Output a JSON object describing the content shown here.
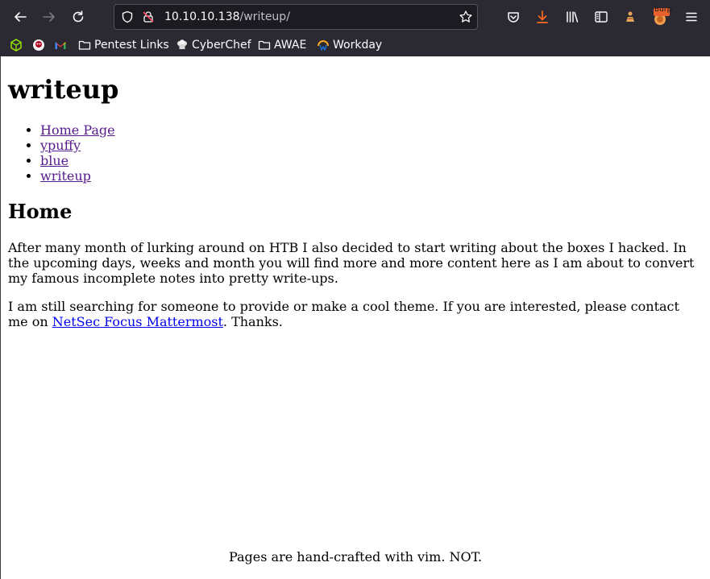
{
  "browser": {
    "url_host": "10.10.10.138",
    "url_path": "/writeup/",
    "bookmarks": [
      "Pentest Links",
      "CyberChef",
      "AWAE",
      "Workday"
    ],
    "burp_badge": "Burp"
  },
  "page": {
    "title": "writeup",
    "nav": [
      "Home Page",
      "ypuffy",
      "blue",
      "writeup"
    ],
    "heading": "Home",
    "paragraph1": "After many month of lurking around on HTB I also decided to start writing about the boxes I hacked. In the upcoming days, weeks and month you will find more and more content here as I am about to convert my famous incomplete notes into pretty write-ups.",
    "paragraph2_before": "I am still searching for someone to provide or make a cool theme. If you are interested, please contact me on",
    "paragraph2_link": "NetSec Focus Mattermost",
    "paragraph2_after": ". Thanks.",
    "footer": "Pages are hand-crafted with vim. NOT."
  },
  "colors": {
    "chrome_bg": "#2b2a33",
    "urlbar_bg": "#1c1b22",
    "visited_link": "#551a8b",
    "unvisited_link": "#0000ee",
    "download_icon": "#ff6a1f"
  }
}
